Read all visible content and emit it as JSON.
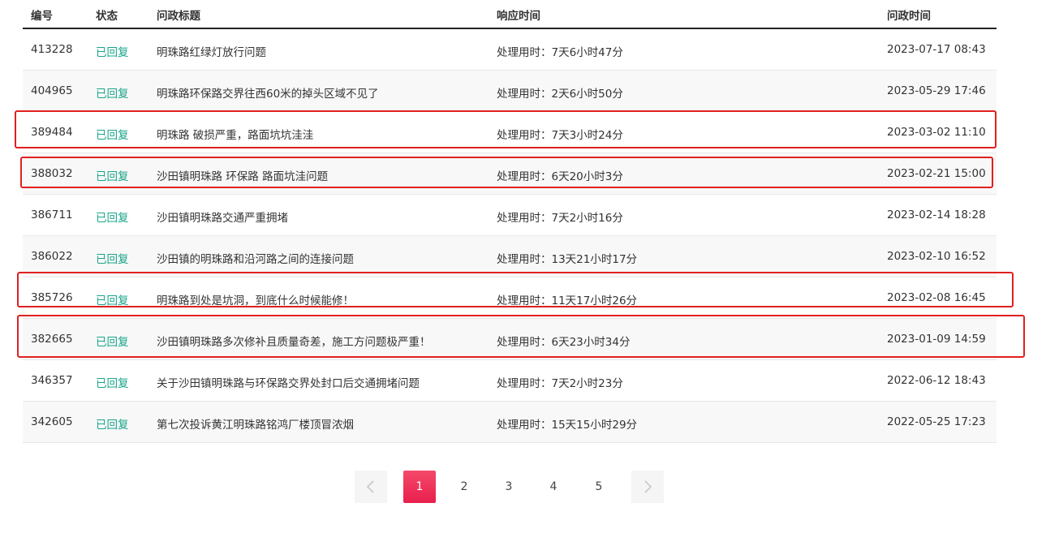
{
  "table": {
    "headers": {
      "id": "编号",
      "status": "状态",
      "title": "问政标题",
      "response": "响应时间",
      "time": "问政时间"
    },
    "rows": [
      {
        "id": "413228",
        "status": "已回复",
        "title": "明珠路红绿灯放行问题",
        "response": "处理用时：7天6小时47分",
        "time": "2023-07-17 08:43"
      },
      {
        "id": "404965",
        "status": "已回复",
        "title": "明珠路环保路交界往西60米的掉头区域不见了",
        "response": "处理用时：2天6小时50分",
        "time": "2023-05-29 17:46"
      },
      {
        "id": "389484",
        "status": "已回复",
        "title": "明珠路 破损严重，路面坑坑洼洼",
        "response": "处理用时：7天3小时24分",
        "time": "2023-03-02 11:10"
      },
      {
        "id": "388032",
        "status": "已回复",
        "title": "沙田镇明珠路 环保路 路面坑洼问题",
        "response": "处理用时：6天20小时3分",
        "time": "2023-02-21 15:00"
      },
      {
        "id": "386711",
        "status": "已回复",
        "title": "沙田镇明珠路交通严重拥堵",
        "response": "处理用时：7天2小时16分",
        "time": "2023-02-14 18:28"
      },
      {
        "id": "386022",
        "status": "已回复",
        "title": "沙田镇的明珠路和沿河路之间的连接问题",
        "response": "处理用时：13天21小时17分",
        "time": "2023-02-10 16:52"
      },
      {
        "id": "385726",
        "status": "已回复",
        "title": "明珠路到处是坑洞，到底什么时候能修！",
        "response": "处理用时：11天17小时26分",
        "time": "2023-02-08 16:45"
      },
      {
        "id": "382665",
        "status": "已回复",
        "title": "沙田镇明珠路多次修补且质量奇差，施工方问题极严重！",
        "response": "处理用时：6天23小时34分",
        "time": "2023-01-09 14:59"
      },
      {
        "id": "346357",
        "status": "已回复",
        "title": "关于沙田镇明珠路与环保路交界处封口后交通拥堵问题",
        "response": "处理用时：7天2小时23分",
        "time": "2022-06-12 18:43"
      },
      {
        "id": "342605",
        "status": "已回复",
        "title": "第七次投诉黄江明珠路铭鸿厂楼顶冒浓烟",
        "response": "处理用时：15天15小时29分",
        "time": "2022-05-25 17:23"
      }
    ]
  },
  "pagination": {
    "prev_icon": "chevron-left-icon",
    "next_icon": "chevron-right-icon",
    "pages": [
      "1",
      "2",
      "3",
      "4",
      "5"
    ],
    "current": "1"
  },
  "colors": {
    "status": "#1aa58a",
    "highlight": "#e02020",
    "active_page": "#e81f4d"
  }
}
